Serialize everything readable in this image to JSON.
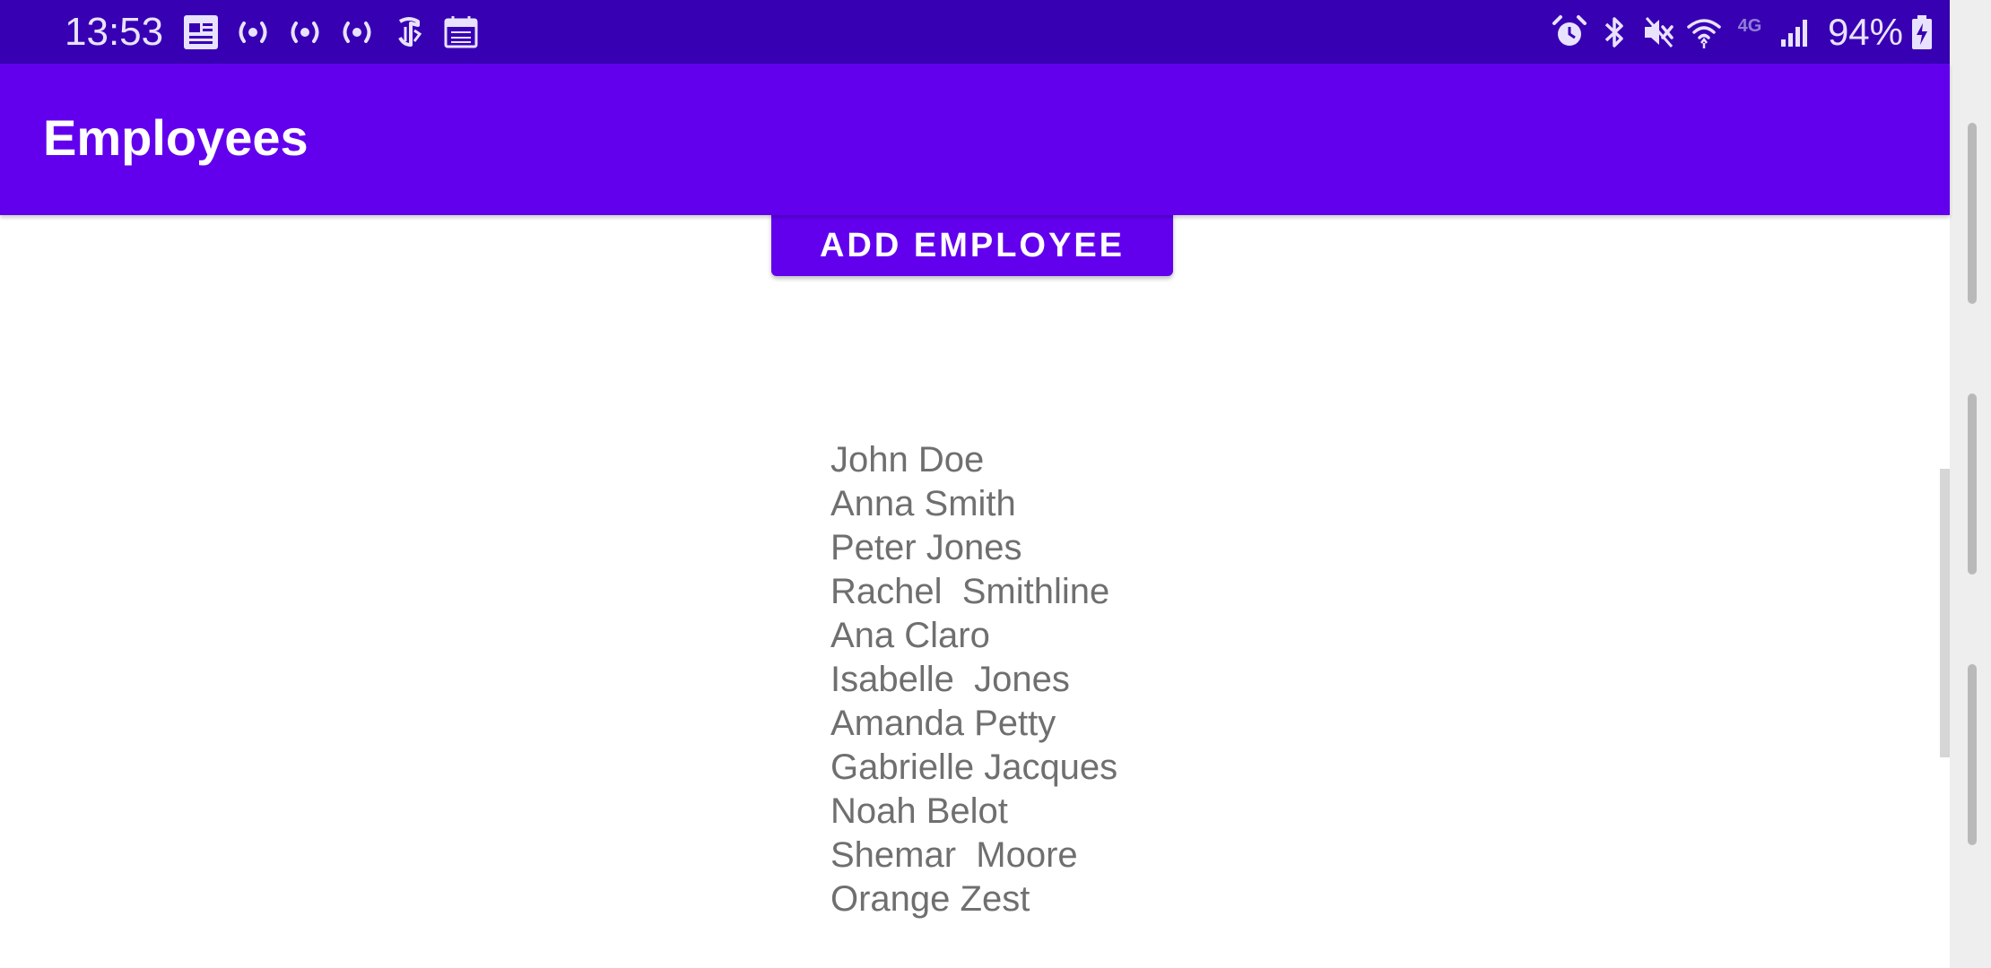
{
  "status_bar": {
    "time": "13:53",
    "left_icons": [
      "news-icon",
      "broadcast-icon",
      "broadcast-icon",
      "broadcast-icon",
      "nyt-icon",
      "calendar-icon"
    ],
    "right_icons": [
      "alarm-icon",
      "bluetooth-icon",
      "mute-icon",
      "wifi-icon",
      "4g-icon",
      "signal-icon"
    ],
    "network_label": "4G",
    "battery_percent": "94%",
    "colors": {
      "background": "#3700b3",
      "foreground": "#e9e2ff"
    }
  },
  "app_bar": {
    "title": "Employees",
    "color": "#6200ee"
  },
  "actions": {
    "add_employee_label": "ADD EMPLOYEE"
  },
  "employees": [
    "John Doe",
    "Anna Smith",
    "Peter Jones",
    "Rachel  Smithline",
    "Ana Claro",
    "Isabelle  Jones",
    "Amanda Petty",
    "Gabrielle Jacques",
    "Noah Belot",
    "Shemar  Moore",
    "Orange Zest"
  ]
}
